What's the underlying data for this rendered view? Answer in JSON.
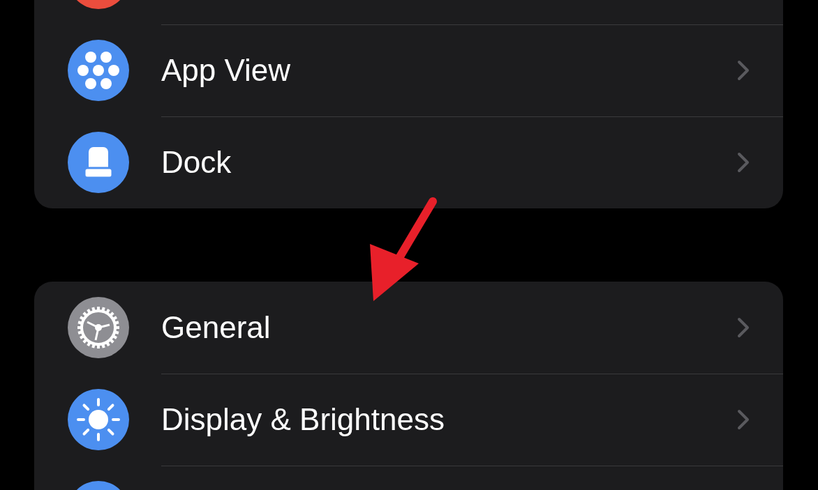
{
  "groups": [
    {
      "rows": [
        {
          "kind": "blank",
          "color": "#eb4d3d"
        },
        {
          "kind": "grid",
          "color": "#4c8ff0",
          "label": "App View"
        },
        {
          "kind": "dock",
          "color": "#4c8ff0",
          "label": "Dock"
        }
      ]
    },
    {
      "rows": [
        {
          "kind": "gear",
          "color": "#8e8e93",
          "label": "General"
        },
        {
          "kind": "sun",
          "color": "#4c8ff0",
          "label": "Display & Brightness"
        },
        {
          "kind": "blank",
          "color": "#4c8ff0"
        }
      ]
    }
  ]
}
